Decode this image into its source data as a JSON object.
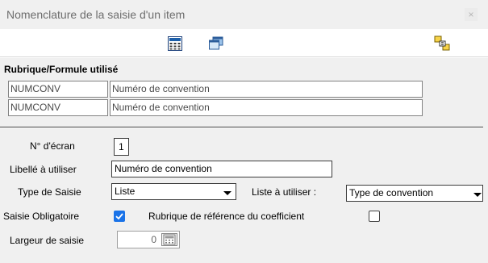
{
  "window": {
    "title": "Nomenclature de la saisie d'un item",
    "close_label": "×"
  },
  "toolbar": {
    "icons": [
      "calculator-icon",
      "window-icon",
      "link-items-icon"
    ]
  },
  "section": {
    "title": "Rubrique/Formule utilisé"
  },
  "rows": [
    {
      "code": "NUMCONV",
      "label": "Numéro de convention"
    },
    {
      "code": "NUMCONV",
      "label": "Numéro de convention"
    }
  ],
  "form": {
    "ecran_label": "N° d'écran",
    "ecran_value": "1",
    "libelle_label": "Libellé à utiliser",
    "libelle_value": "Numéro de convention",
    "type_label": "Type de Saisie",
    "type_value": "Liste",
    "liste_label": "Liste à utiliser :",
    "liste_value": "Type de convention",
    "obligatoire_label": "Saisie Obligatoire",
    "obligatoire_checked": true,
    "reference_label": "Rubrique de référence du coefficient",
    "reference_checked": false,
    "largeur_label": "Largeur de saisie",
    "largeur_value": "0"
  },
  "colors": {
    "accent": "#1a73e8",
    "background": "#f0f0f0"
  }
}
